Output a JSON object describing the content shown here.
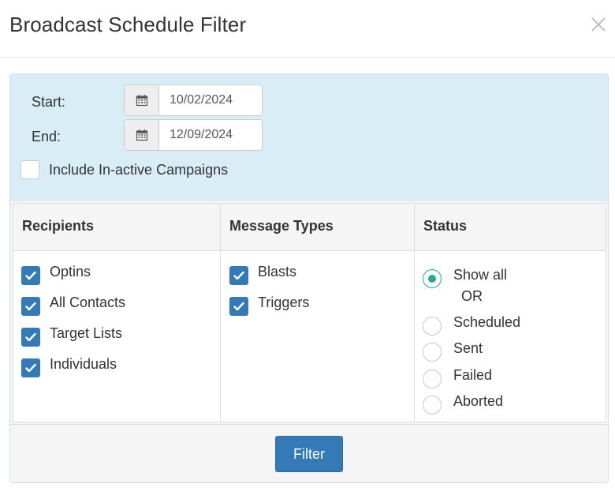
{
  "dialog": {
    "title": "Broadcast Schedule Filter"
  },
  "date_range": {
    "start_label": "Start:",
    "start_value": "10/02/2024",
    "end_label": "End:",
    "end_value": "12/09/2024",
    "inactive_label": "Include In-active Campaigns",
    "inactive_checked": false
  },
  "recipients": {
    "header": "Recipients",
    "items": [
      {
        "label": "Optins",
        "checked": true
      },
      {
        "label": "All Contacts",
        "checked": true
      },
      {
        "label": "Target Lists",
        "checked": true
      },
      {
        "label": "Individuals",
        "checked": true
      }
    ]
  },
  "message_types": {
    "header": "Message Types",
    "items": [
      {
        "label": "Blasts",
        "checked": true
      },
      {
        "label": "Triggers",
        "checked": true
      }
    ]
  },
  "status": {
    "header": "Status",
    "separator": "OR",
    "options": [
      {
        "label": "Show all",
        "selected": true
      },
      {
        "label": "Scheduled",
        "selected": false
      },
      {
        "label": "Sent",
        "selected": false
      },
      {
        "label": "Failed",
        "selected": false
      },
      {
        "label": "Aborted",
        "selected": false
      }
    ]
  },
  "footer": {
    "filter_label": "Filter"
  },
  "colors": {
    "primary": "#337ab7",
    "radio_selected": "#26a69a",
    "range_background": "#d9edf7"
  }
}
